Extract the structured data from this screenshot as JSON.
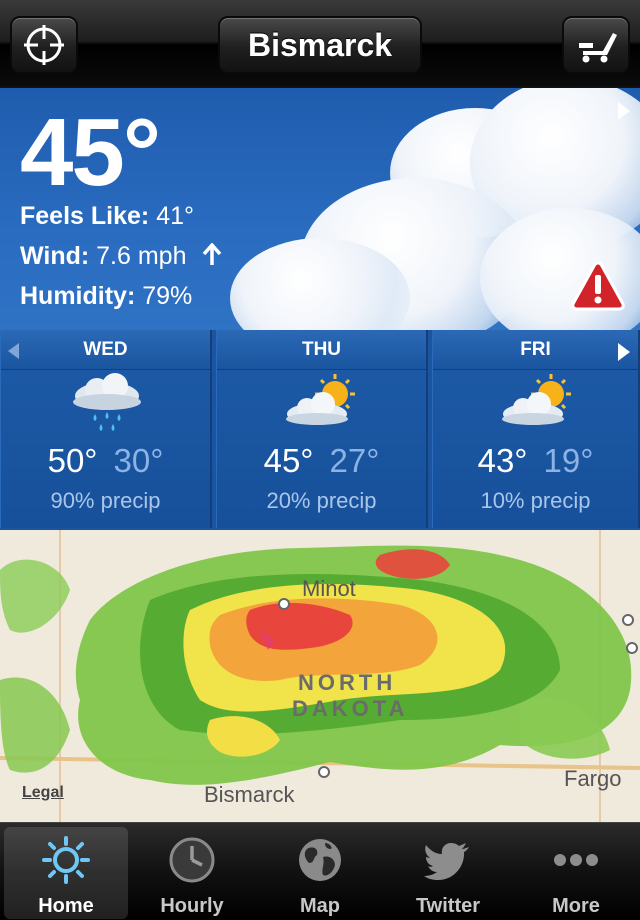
{
  "top_bar": {
    "title": "Bismarck",
    "left_icon": "crosshair-location-icon",
    "right_icon": "preferences-icon"
  },
  "current": {
    "temperature": "45°",
    "feels_like_label": "Feels Like:",
    "feels_like_value": "41°",
    "wind_label": "Wind:",
    "wind_value": "7.6 mph",
    "wind_direction_icon": "arrow-up-icon",
    "humidity_label": "Humidity:",
    "humidity_value": "79%",
    "alert_icon": "alert-warning-icon"
  },
  "forecast": [
    {
      "day": "WED",
      "icon": "rain-cloud-icon",
      "high": "50°",
      "low": "30°",
      "precip": "90% precip"
    },
    {
      "day": "THU",
      "icon": "partly-cloudy-icon",
      "high": "45°",
      "low": "27°",
      "precip": "20% precip"
    },
    {
      "day": "FRI",
      "icon": "partly-cloudy-icon",
      "high": "43°",
      "low": "19°",
      "precip": "10% precip"
    }
  ],
  "map": {
    "labels": {
      "minot": "Minot",
      "state_line1": "NORTH",
      "state_line2": "DAKOTA",
      "bismarck": "Bismarck",
      "fargo": "Fargo"
    },
    "legal": "Legal"
  },
  "tabs": [
    {
      "label": "Home",
      "icon": "sun-icon",
      "active": true
    },
    {
      "label": "Hourly",
      "icon": "clock-icon",
      "active": false
    },
    {
      "label": "Map",
      "icon": "globe-icon",
      "active": false
    },
    {
      "label": "Twitter",
      "icon": "twitter-bird-icon",
      "active": false
    },
    {
      "label": "More",
      "icon": "more-dots-icon",
      "active": false
    }
  ],
  "colors": {
    "sky_blue": "#2a6cc0",
    "forecast_blue": "#1b559f",
    "alert_red": "#d2232a"
  }
}
